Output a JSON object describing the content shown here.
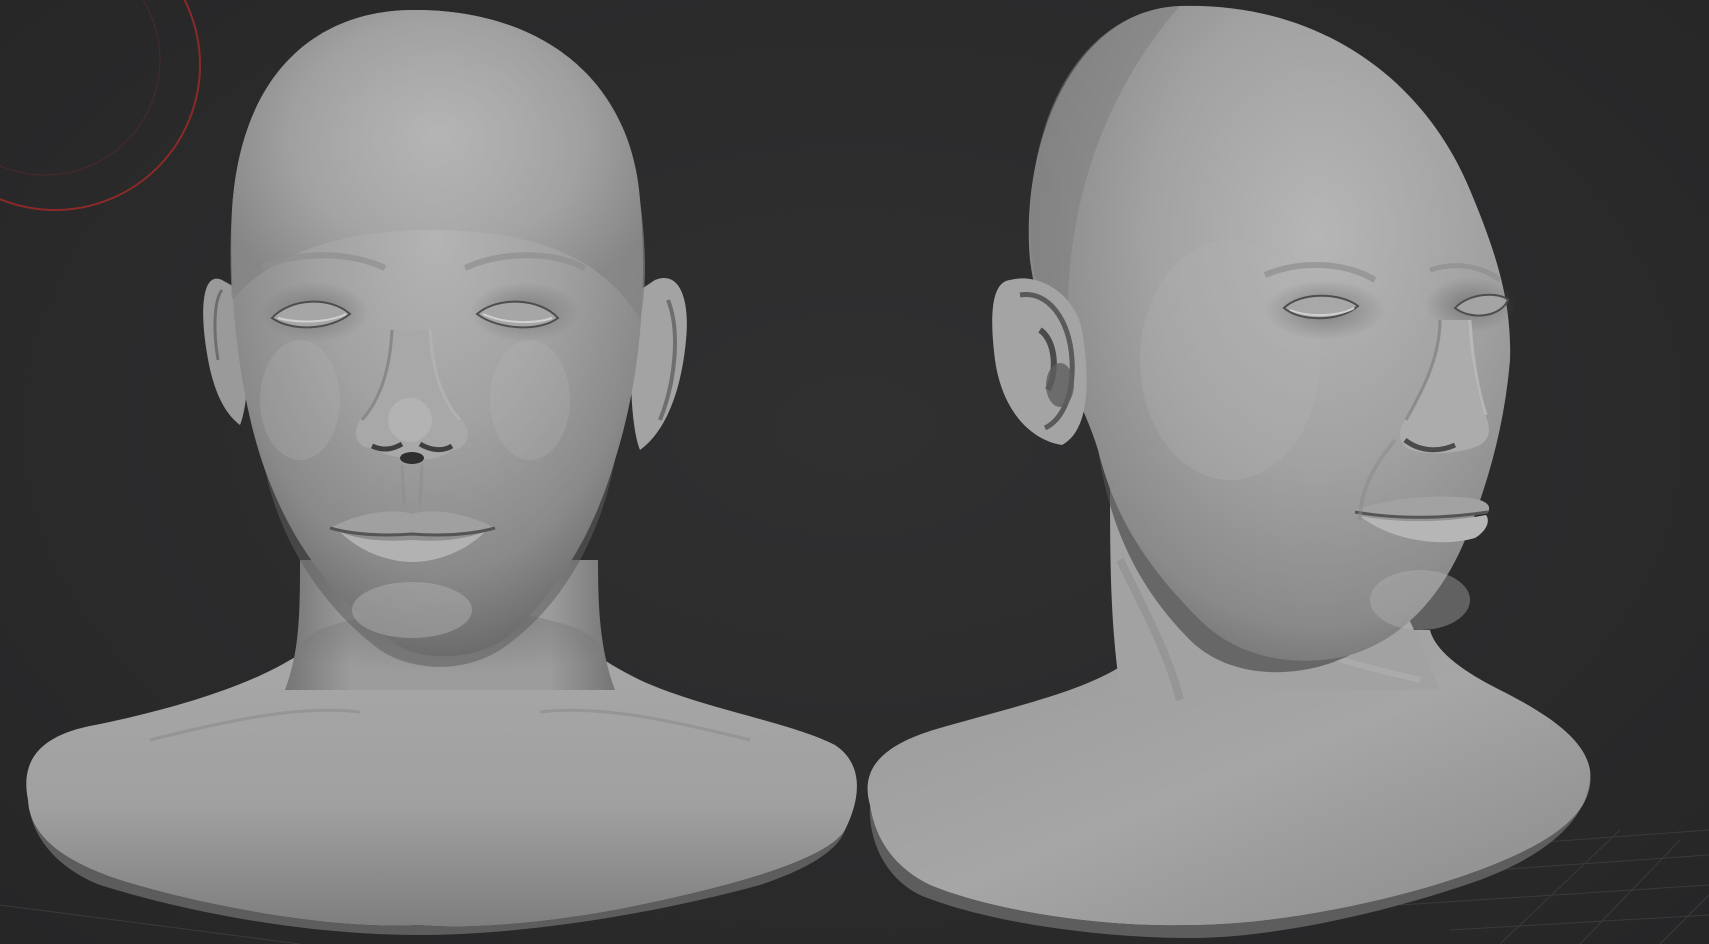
{
  "viewport": {
    "background_color": "#2a2a2b",
    "model_color": "#9a9a9a",
    "brush_cursor_color": "#8a2a28",
    "floor_grid_color": "#3a3a3b"
  },
  "scene": {
    "objects": [
      "sculpted-head-front-view",
      "sculpted-head-three-quarter-view"
    ],
    "brush_cursor_icon": "brush-circle-icon",
    "floor_grid_icon": "perspective-grid-icon"
  }
}
